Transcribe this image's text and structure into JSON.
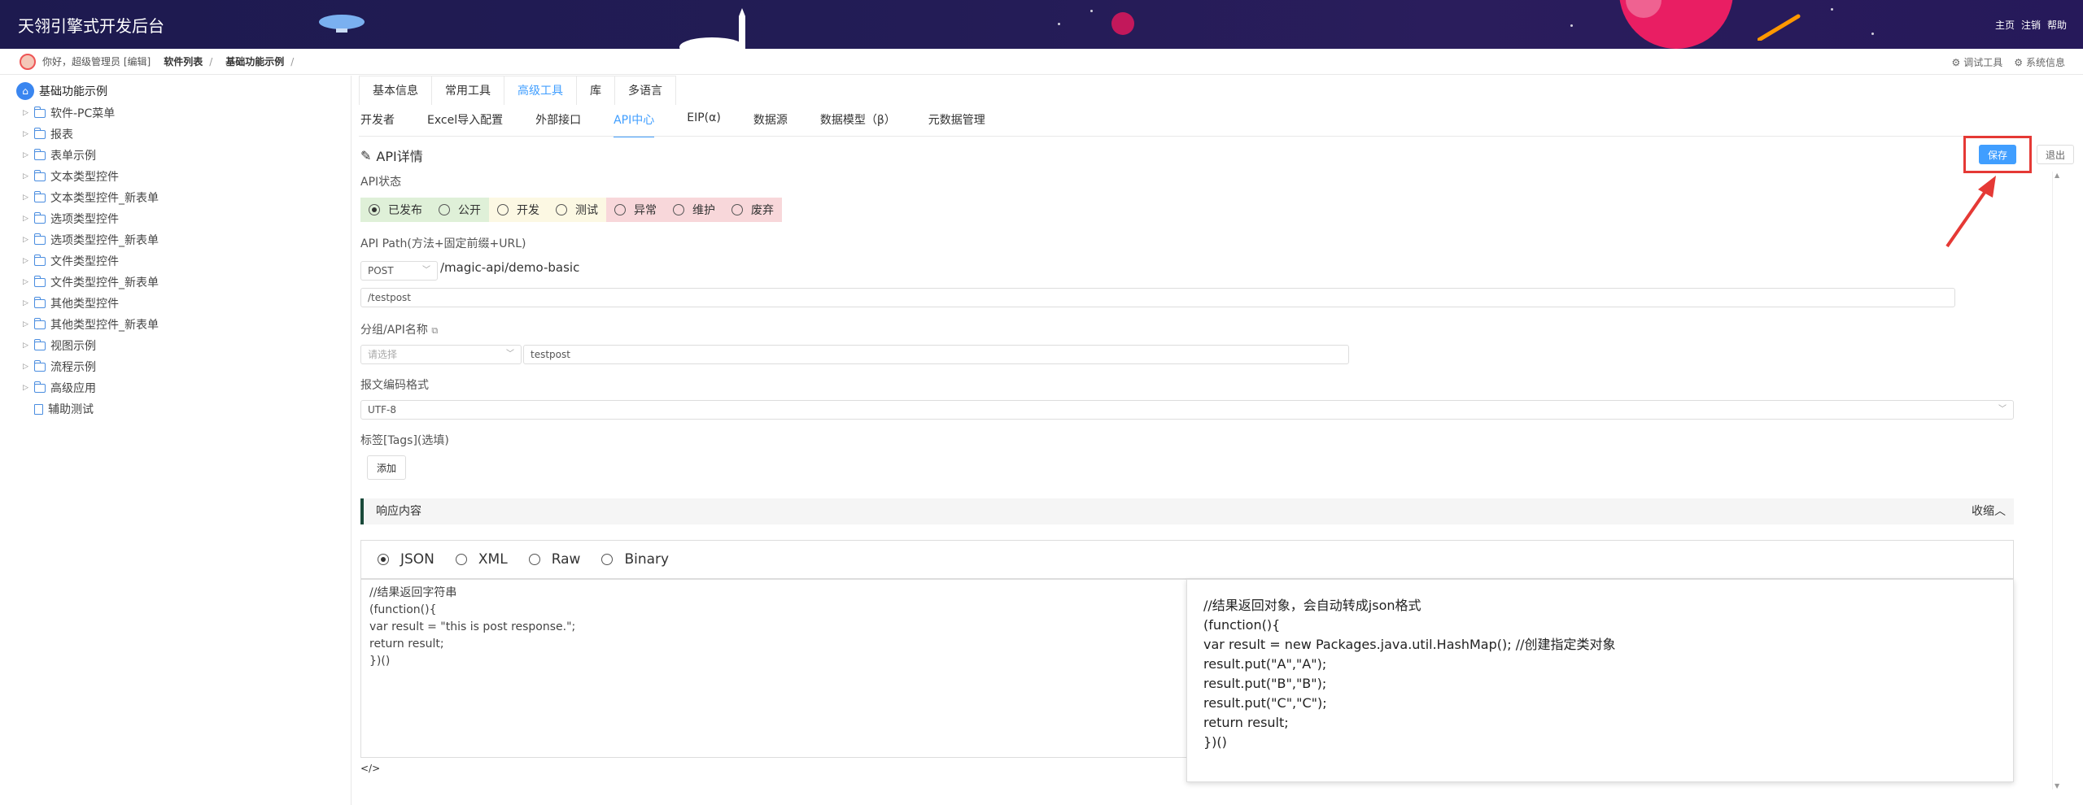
{
  "header": {
    "brand": "天翎引擎式开发后台",
    "links": [
      "主页",
      "注销",
      "帮助"
    ]
  },
  "crumbbar": {
    "greeting": "你好，超级管理员 [编辑]",
    "crumbs": [
      "软件列表",
      "基础功能示例"
    ],
    "separator": "/",
    "right_links": [
      "调试工具",
      "系统信息"
    ]
  },
  "sidebar": {
    "root": "基础功能示例",
    "items": [
      {
        "label": "软件-PC菜单",
        "type": "folder"
      },
      {
        "label": "报表",
        "type": "folder"
      },
      {
        "label": "表单示例",
        "type": "folder"
      },
      {
        "label": "文本类型控件",
        "type": "folder"
      },
      {
        "label": "文本类型控件_新表单",
        "type": "folder"
      },
      {
        "label": "选项类型控件",
        "type": "folder"
      },
      {
        "label": "选项类型控件_新表单",
        "type": "folder"
      },
      {
        "label": "文件类型控件",
        "type": "folder"
      },
      {
        "label": "文件类型控件_新表单",
        "type": "folder"
      },
      {
        "label": "其他类型控件",
        "type": "folder"
      },
      {
        "label": "其他类型控件_新表单",
        "type": "folder"
      },
      {
        "label": "视图示例",
        "type": "folder"
      },
      {
        "label": "流程示例",
        "type": "folder"
      },
      {
        "label": "高级应用",
        "type": "folder"
      },
      {
        "label": "辅助测试",
        "type": "doc"
      }
    ]
  },
  "tabs1": [
    "基本信息",
    "常用工具",
    "高级工具",
    "库",
    "多语言"
  ],
  "tabs1_active": "高级工具",
  "tabs2": [
    "开发者",
    "Excel导入配置",
    "外部接口",
    "API中心",
    "EIP(α)",
    "数据源",
    "数据模型（β）",
    "元数据管理"
  ],
  "tabs2_active": "API中心",
  "api": {
    "section_title": "API详情",
    "save_label": "保存",
    "exit_label": "退出",
    "status_label": "API状态",
    "status_options": [
      {
        "label": "已发布",
        "checked": true,
        "bg": "#dff0d8"
      },
      {
        "label": "公开",
        "checked": false,
        "bg": "#dff0d8"
      },
      {
        "label": "开发",
        "checked": false,
        "bg": "#fcf8e3"
      },
      {
        "label": "测试",
        "checked": false,
        "bg": "#fcf8e3"
      },
      {
        "label": "异常",
        "checked": false,
        "bg": "#f8d7da"
      },
      {
        "label": "维护",
        "checked": false,
        "bg": "#f8d7da"
      },
      {
        "label": "废弃",
        "checked": false,
        "bg": "#f8d7da"
      }
    ],
    "path_label": "API Path(方法+固定前缀+URL)",
    "method": "POST",
    "prefix": "/magic-api/demo-basic",
    "url": "/testpost",
    "group_label": "分组/API名称",
    "group_placeholder": "请选择",
    "api_name": "testpost",
    "encoding_label": "报文编码格式",
    "encoding": "UTF-8",
    "tags_label": "标签[Tags](选填)",
    "add_label": "添加",
    "response_label": "响应内容",
    "collapse_label": "收缩",
    "formats": [
      {
        "label": "JSON",
        "checked": true
      },
      {
        "label": "XML",
        "checked": false
      },
      {
        "label": "Raw",
        "checked": false
      },
      {
        "label": "Binary",
        "checked": false
      }
    ],
    "code_left": "//结果返回字符串\n(function(){\nvar result = \"this is post response.\";\nreturn result;\n})()",
    "code_right": "//结果返回对象，会自动转成json格式\n(function(){\nvar result = new Packages.java.util.HashMap(); //创建指定类对象\nresult.put(\"A\",\"A\");\nresult.put(\"B\",\"B\");\nresult.put(\"C\",\"C\");\nreturn result;\n})()",
    "code_icon": "</>"
  },
  "colors": {
    "header_bg": "#1d1a4f",
    "accent": "#409eff",
    "highlight": "#e53935"
  }
}
